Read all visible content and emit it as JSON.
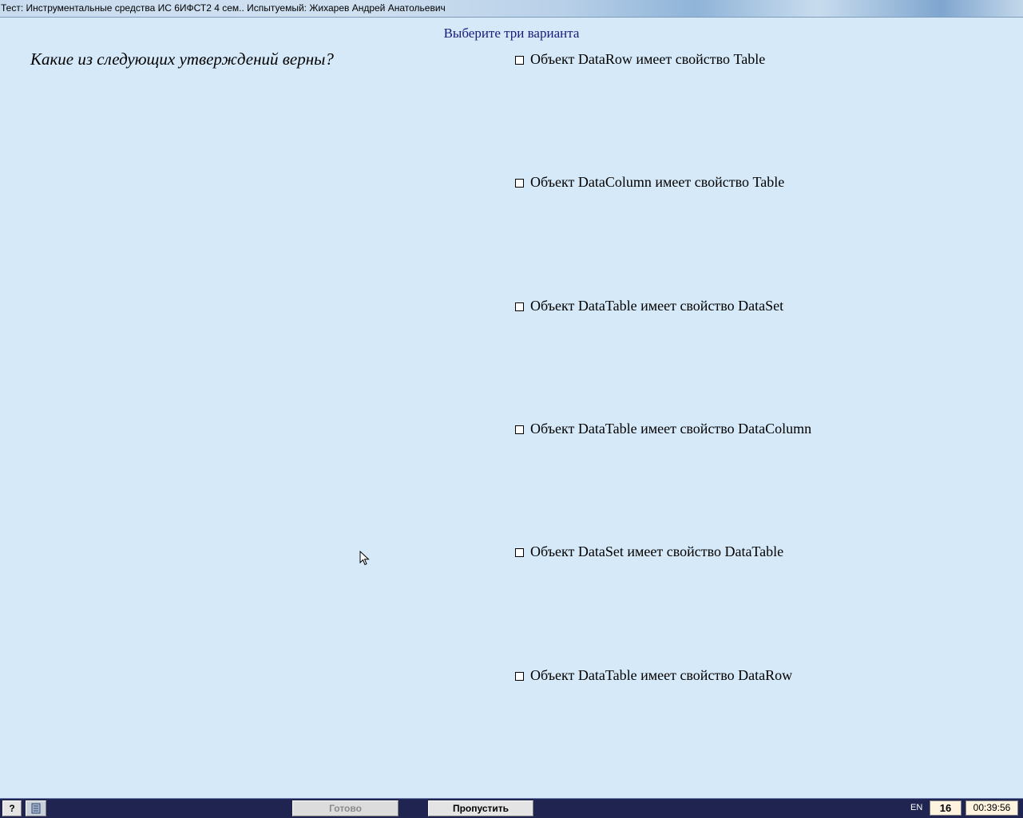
{
  "window": {
    "title": "Тест: Инструментальные средства ИС 6ИФСТ2 4 сем.. Испытуемый: Жихарев Андрей Анатольевич"
  },
  "instruction": "Выберите три варианта",
  "question": "Какие из следующих утверждений верны?",
  "options": [
    {
      "label": "Объект DataRow имеет свойство Table",
      "checked": false
    },
    {
      "label": "Объект DataColumn имеет свойство Table",
      "checked": false
    },
    {
      "label": "Объект DataTable имеет свойство DataSet",
      "checked": false
    },
    {
      "label": "Объект DataTable имеет свойство DataColumn",
      "checked": false
    },
    {
      "label": "Объект DataSet имеет свойство DataTable",
      "checked": false
    },
    {
      "label": "Объект DataTable имеет свойство DataRow",
      "checked": false
    }
  ],
  "taskbar": {
    "help_label": "?",
    "book_icon": "book-icon",
    "done_label": "Готово",
    "done_enabled": false,
    "skip_label": "Пропустить",
    "language": "EN",
    "question_number": "16",
    "timer": "00:39:56"
  },
  "colors": {
    "background": "#d6e9f8",
    "instruction_text": "#1a1a7a",
    "taskbar": "#1f2450"
  }
}
